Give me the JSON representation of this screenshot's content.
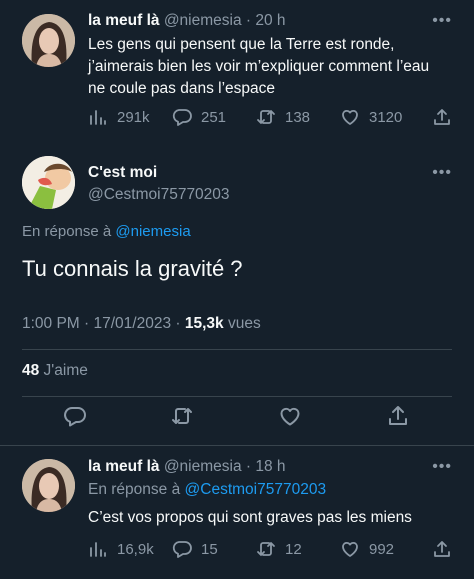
{
  "tweet1": {
    "display_name": "la meuf là",
    "handle": "@niemesia",
    "sep": " · ",
    "time": "20 h",
    "text_lines": [
      "Les gens qui pensent que la Terre est ronde,",
      "j’aimerais bien les voir m’expliquer comment l’eau",
      "ne coule pas dans l’espace"
    ],
    "views": "291k",
    "replies": "251",
    "retweets": "138",
    "likes": "3120"
  },
  "main_tweet": {
    "display_name": "C'est moi",
    "handle": "@Cestmoi75770203",
    "reply_prefix": "En réponse à ",
    "reply_to": "@niemesia",
    "text": "Tu connais la gravité ?",
    "time": "1:00 PM · 17/01/2023 · ",
    "views_count": "15,3k",
    "views_label": " vues",
    "likes_count": "48",
    "likes_label": " J'aime"
  },
  "tweet3": {
    "display_name": "la meuf là",
    "handle": "@niemesia",
    "sep": " · ",
    "time": "18 h",
    "reply_prefix": "En réponse à ",
    "reply_to": "@Cestmoi75770203",
    "text": "C’est vos propos qui sont graves pas les miens",
    "views": "16,9k",
    "replies": "15",
    "retweets": "12",
    "likes": "992"
  },
  "more_glyph": "•••",
  "colors": {
    "background": "#15202b",
    "accent": "#1d9bf0",
    "muted": "#8b98a5",
    "divider": "#38444d"
  }
}
